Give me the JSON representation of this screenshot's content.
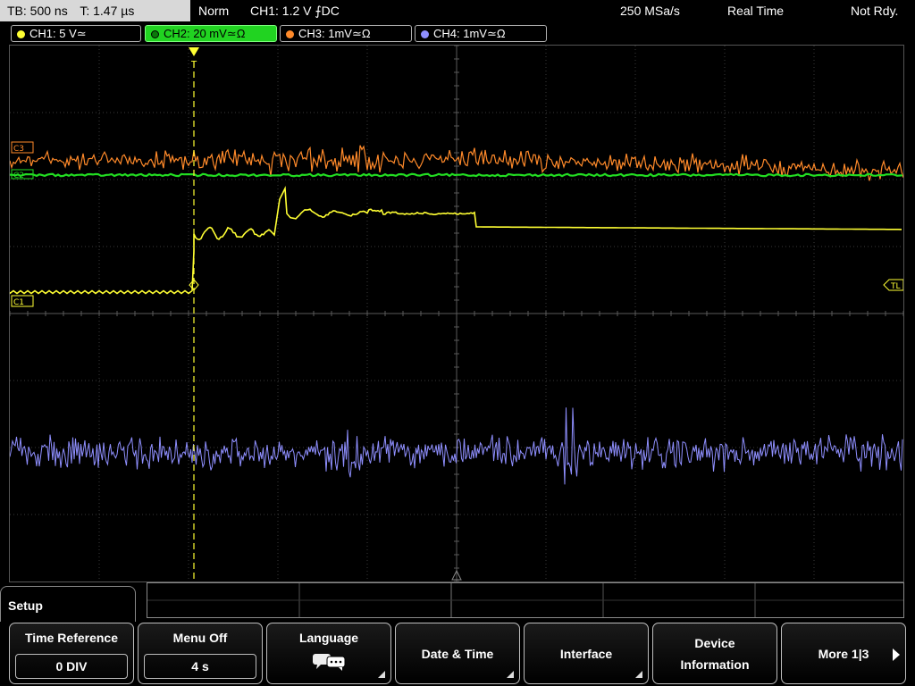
{
  "status": {
    "timebase": "TB: 500 ns",
    "trigger_time": "T: 1.47 µs",
    "mode": "Norm",
    "trigger_info": "CH1: 1.2 V ⨍DC",
    "sample_rate": "250 MSa/s",
    "acq_mode": "Real Time",
    "ready_state": "Not Rdy."
  },
  "channels": [
    {
      "label": "CH1: 5 V≃",
      "color": "#ffff33",
      "active": false
    },
    {
      "label": "CH2: 20 mV≃Ω",
      "color": "#22dd22",
      "active": true
    },
    {
      "label": "CH3: 1mV≃Ω",
      "color": "#ff8a2a",
      "active": false
    },
    {
      "label": "CH4: 1mV≃Ω",
      "color": "#8f8fff",
      "active": false
    }
  ],
  "markers": {
    "c3": "C3",
    "c2": "C2",
    "c1": "C1",
    "trigger_level": "TL",
    "trigger_pos": "T"
  },
  "menu": {
    "title": "Setup",
    "softkeys": [
      {
        "label": "Time Reference",
        "value": "0 DIV"
      },
      {
        "label": "Menu Off",
        "value": "4 s"
      },
      {
        "label": "Language",
        "icon": "speech-bubbles-icon"
      },
      {
        "label": "Date & Time"
      },
      {
        "label": "Interface"
      },
      {
        "label": "Device Information"
      },
      {
        "label": "More 1|3"
      }
    ]
  },
  "colors": {
    "ch1": "#ffff33",
    "ch2": "#22dd22",
    "ch3": "#ff8a2a",
    "ch4": "#8f8fff",
    "grid": "#3a3a3a"
  }
}
